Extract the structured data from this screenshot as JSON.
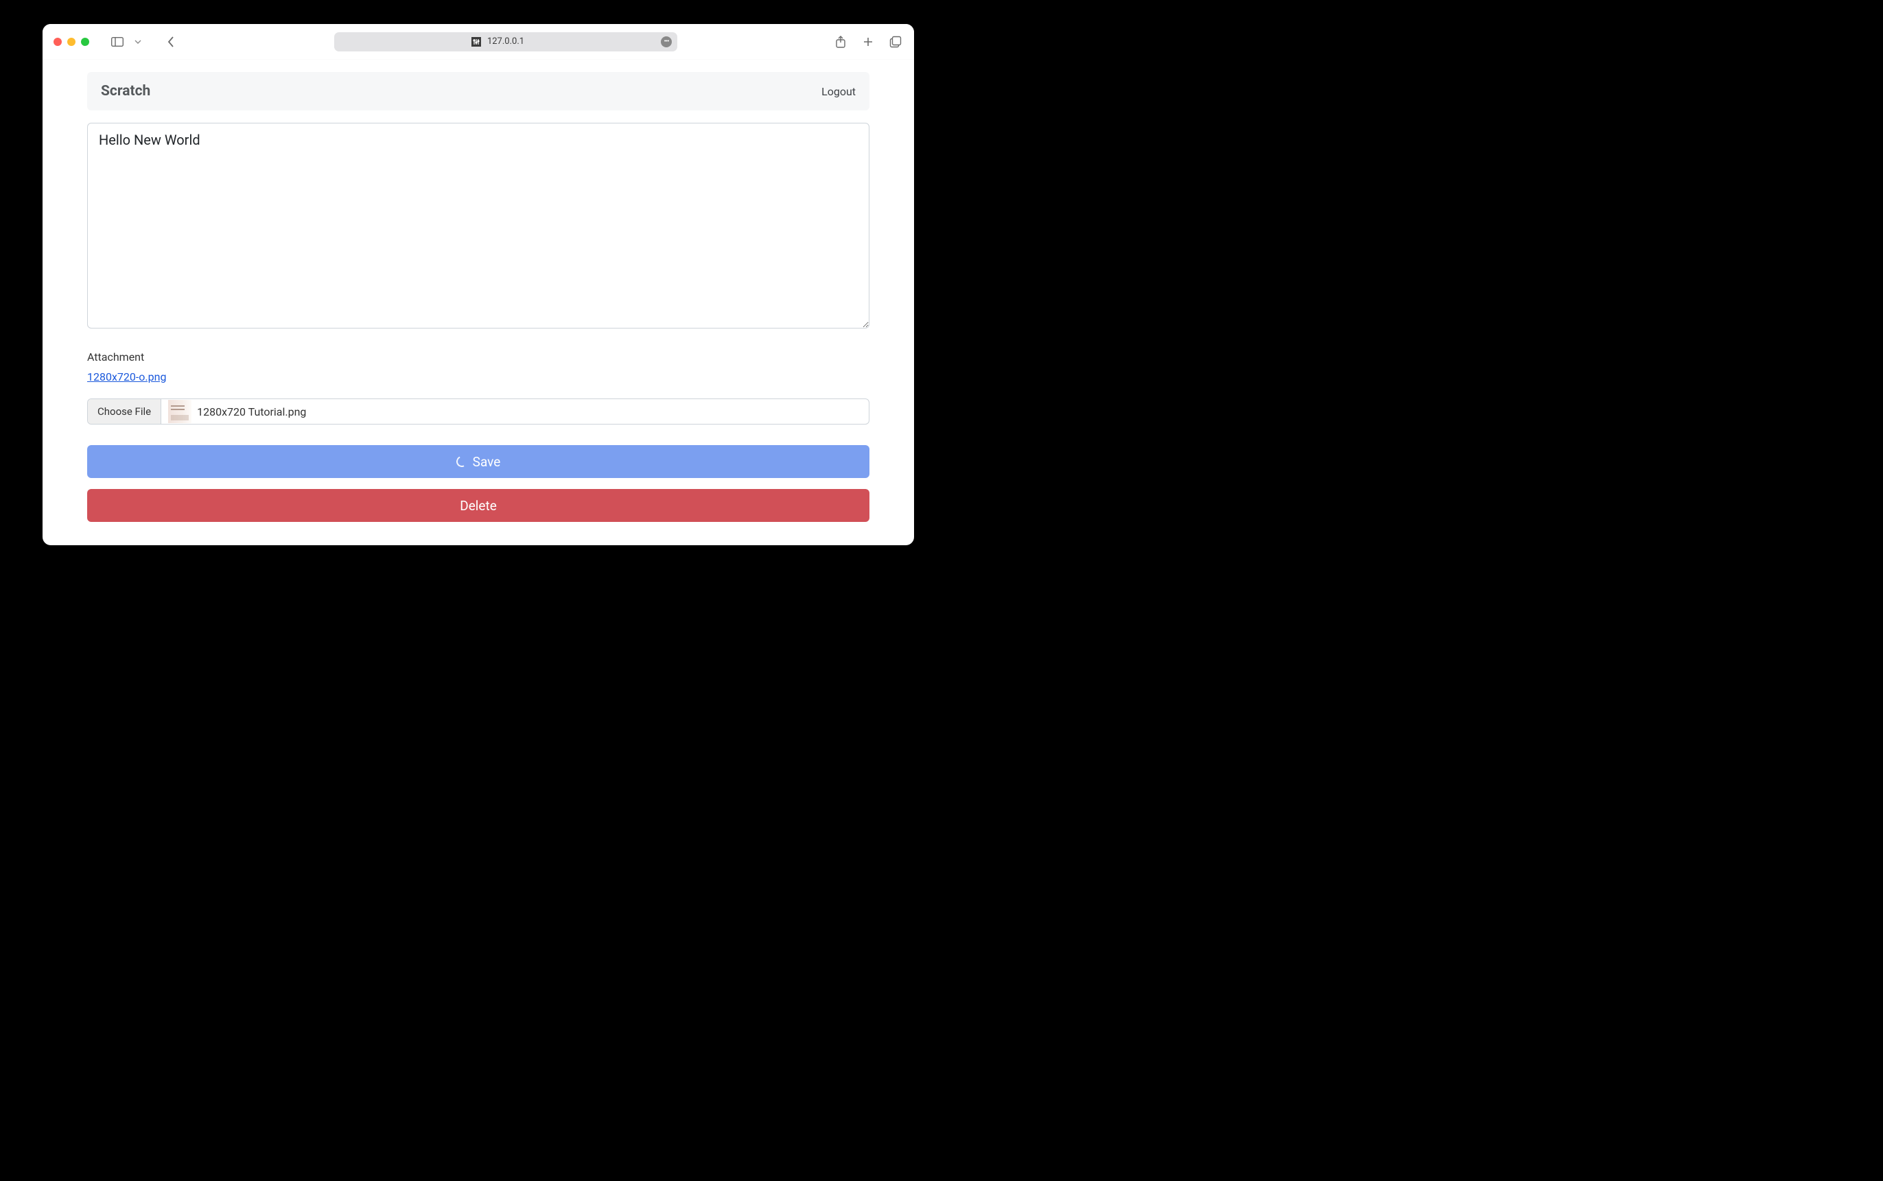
{
  "browser": {
    "address": "127.0.0.1"
  },
  "header": {
    "title": "Scratch",
    "logout": "Logout"
  },
  "editor": {
    "value": "Hello New World"
  },
  "attachment": {
    "label": "Attachment",
    "existing_link_text": "1280x720-o.png",
    "choose_label": "Choose File",
    "selected_filename": "1280x720 Tutorial.png"
  },
  "buttons": {
    "save": "Save",
    "delete": "Delete"
  }
}
